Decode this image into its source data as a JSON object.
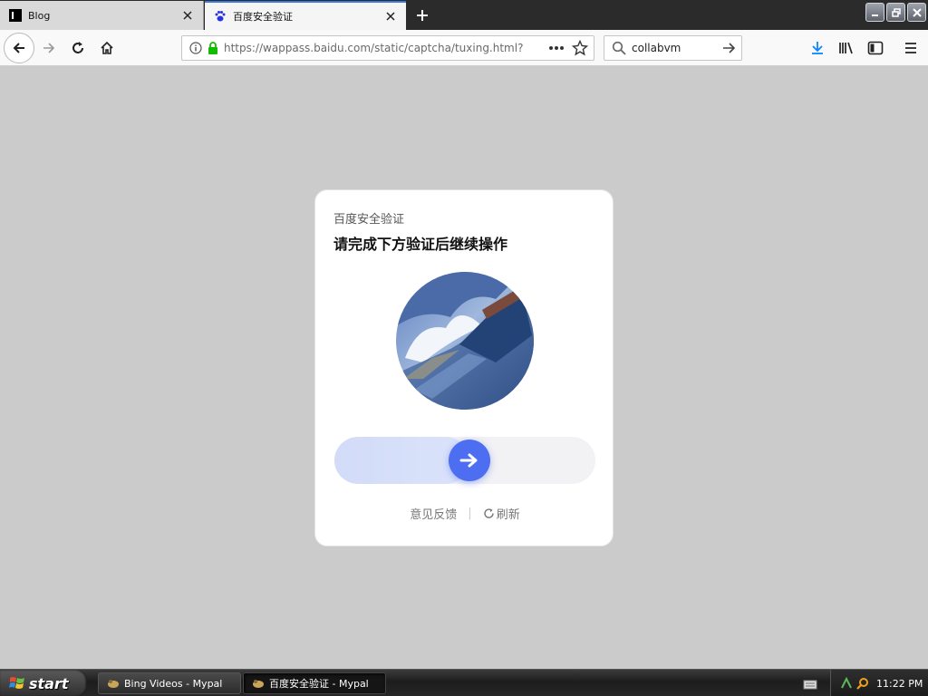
{
  "tabs": [
    {
      "title": "Blog",
      "active": false
    },
    {
      "title": "百度安全验证",
      "active": true
    }
  ],
  "navbar": {
    "url": "https://wappass.baidu.com/static/captcha/tuxing.html?",
    "search_query": "collabvm"
  },
  "captcha": {
    "subtitle": "百度安全验证",
    "title": "请完成下方验证后继续操作",
    "slider_progress": 0.52,
    "feedback_label": "意见反馈",
    "separator": "|",
    "refresh_label": "刷新"
  },
  "taskbar": {
    "start_label": "start",
    "tasks": [
      {
        "label": "Bing Videos - Mypal",
        "active": false
      },
      {
        "label": "百度安全验证 - Mypal",
        "active": true
      }
    ],
    "clock": "11:22 PM"
  },
  "colors": {
    "accent": "#4e6ef2",
    "page_bg": "#cbcbcb",
    "secure_lock": "#12bc00",
    "download": "#0a84ff"
  },
  "icons": {
    "tab1": "blog-favicon",
    "tab2": "baidu-paw-icon",
    "slider": "arrow-right-icon",
    "refresh": "refresh-icon"
  }
}
